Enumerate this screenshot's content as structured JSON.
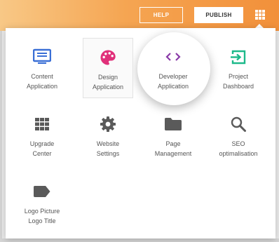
{
  "header": {
    "help_label": "HELP",
    "publish_label": "PUBLISH"
  },
  "apps": [
    {
      "line1": "Content",
      "line2": "Application",
      "icon": "content-application-icon",
      "color": "#3a6fd6"
    },
    {
      "line1": "Design",
      "line2": "Application",
      "icon": "palette-icon",
      "color": "#e0307a"
    },
    {
      "line1": "Developer",
      "line2": "Application",
      "icon": "code-icon",
      "color": "#8a3aa8"
    },
    {
      "line1": "Project",
      "line2": "Dashboard",
      "icon": "dashboard-enter-icon",
      "color": "#1db98a"
    },
    {
      "line1": "Upgrade",
      "line2": "Center",
      "icon": "grid-icon",
      "color": "#5a5a5a"
    },
    {
      "line1": "Website",
      "line2": "Settings",
      "icon": "gear-icon",
      "color": "#5a5a5a"
    },
    {
      "line1": "Page",
      "line2": "Management",
      "icon": "folder-icon",
      "color": "#5a5a5a"
    },
    {
      "line1": "SEO",
      "line2": "optimalisation",
      "icon": "search-icon",
      "color": "#5a5a5a"
    },
    {
      "line1": "Logo Picture",
      "line2": "Logo Title",
      "icon": "tag-icon",
      "color": "#5a5a5a"
    }
  ]
}
